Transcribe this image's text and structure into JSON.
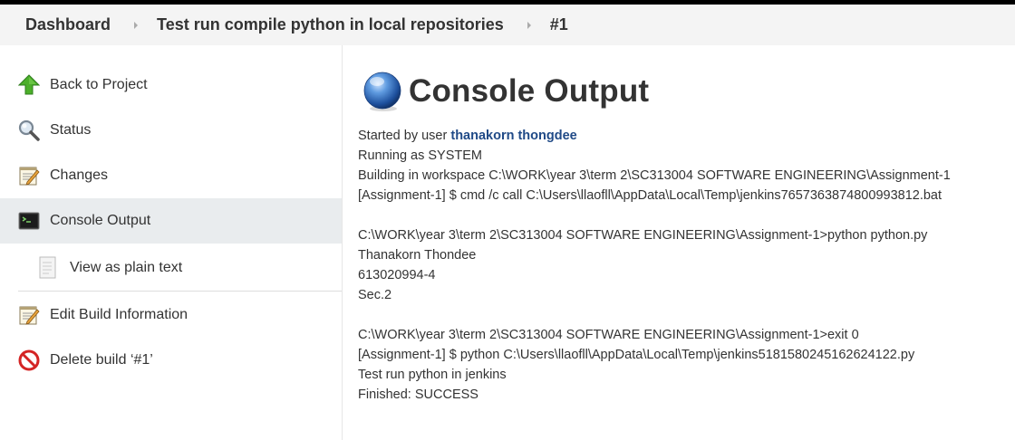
{
  "breadcrumb": {
    "items": [
      "Dashboard",
      "Test run compile python in local repositories",
      "#1"
    ]
  },
  "sidebar": {
    "items": [
      {
        "label": "Back to Project",
        "icon": "up-arrow-icon"
      },
      {
        "label": "Status",
        "icon": "magnifier-icon"
      },
      {
        "label": "Changes",
        "icon": "notepad-icon"
      },
      {
        "label": "Console Output",
        "icon": "terminal-icon"
      },
      {
        "label": "View as plain text",
        "icon": "document-icon"
      },
      {
        "label": "Edit Build Information",
        "icon": "notepad-icon"
      },
      {
        "label": "Delete build ‘#1’",
        "icon": "no-entry-icon"
      }
    ]
  },
  "main": {
    "title": "Console Output",
    "started_prefix": "Started by user ",
    "started_user": "thanakorn thongdee",
    "lines": [
      "Running as SYSTEM",
      "Building in workspace C:\\WORK\\year 3\\term 2\\SC313004 SOFTWARE ENGINEERING\\Assignment-1",
      "[Assignment-1] $ cmd /c call C:\\Users\\llaofll\\AppData\\Local\\Temp\\jenkins7657363874800993812.bat",
      "",
      "C:\\WORK\\year 3\\term 2\\SC313004 SOFTWARE ENGINEERING\\Assignment-1>python python.py",
      "Thanakorn Thondee",
      "613020994-4",
      "Sec.2",
      "",
      "C:\\WORK\\year 3\\term 2\\SC313004 SOFTWARE ENGINEERING\\Assignment-1>exit 0",
      "[Assignment-1] $ python C:\\Users\\llaofll\\AppData\\Local\\Temp\\jenkins5181580245162624122.py",
      "Test run python in jenkins",
      "Finished: SUCCESS"
    ]
  },
  "colors": {
    "link": "#204a87",
    "active_bg": "#e9ecee",
    "breadcrumb_bg": "#f4f4f4"
  }
}
